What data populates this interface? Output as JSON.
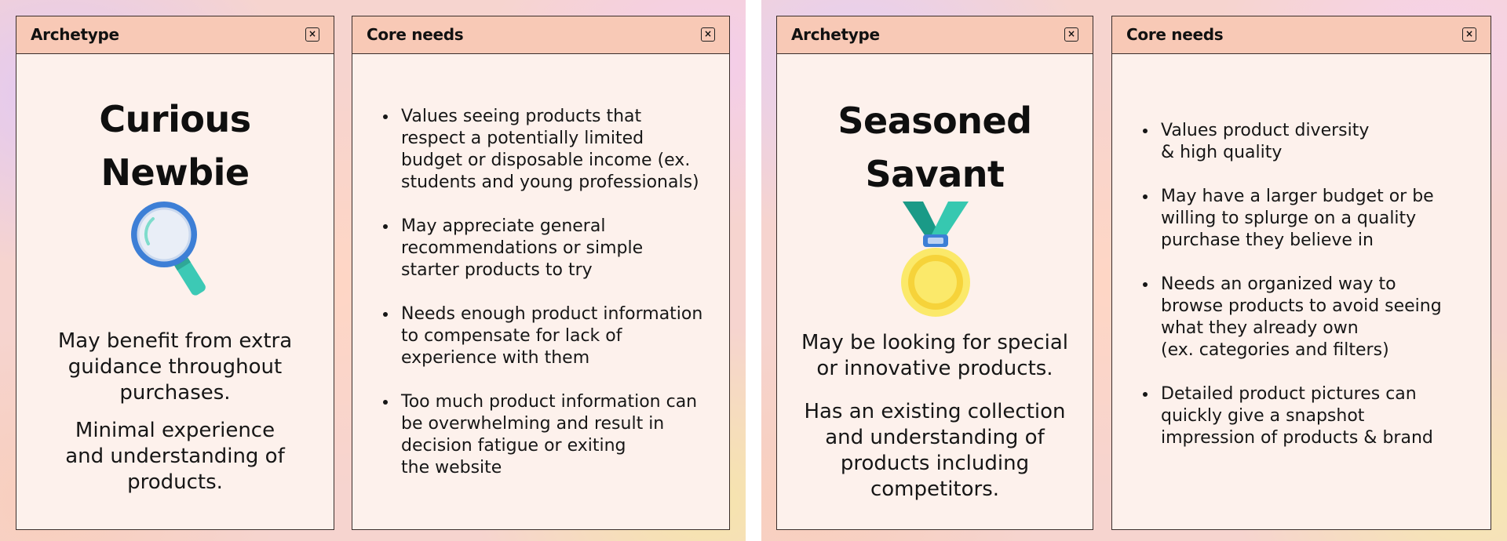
{
  "panels": [
    {
      "archetype_card": {
        "title": "Archetype",
        "close_icon": "×",
        "name_line1": "Curious",
        "name_line2": "Newbie",
        "illustration": "magnifying-glass-icon",
        "desc1": "May benefit from extra\nguidance throughout\npurchases.",
        "desc2": "Minimal experience\nand understanding of\nproducts."
      },
      "needs_card": {
        "title": "Core needs",
        "close_icon": "×",
        "items": [
          "Values seeing products that\nrespect a potentially limited\nbudget or disposable income (ex.\nstudents and young professionals)",
          "May appreciate general\nrecommendations or simple\nstarter products to try",
          "Needs enough product information\nto compensate for lack of\nexperience with them",
          "Too much product information can\nbe overwhelming and result in\ndecision fatigue or exiting\nthe website"
        ]
      }
    },
    {
      "archetype_card": {
        "title": "Archetype",
        "close_icon": "×",
        "name_line1": "Seasoned",
        "name_line2": "Savant",
        "illustration": "medal-icon",
        "desc1": "May be looking for special\nor innovative products.",
        "desc2": "Has an existing collection\nand understanding of\nproducts including\ncompetitors."
      },
      "needs_card": {
        "title": "Core needs",
        "close_icon": "×",
        "items": [
          "Values product diversity\n& high quality",
          "May have a larger budget or be\nwilling to splurge on a quality\npurchase they believe in",
          "Needs an organized way to\nbrowse products to avoid seeing\nwhat they already own\n(ex. categories and filters)",
          "Detailed product pictures can\nquickly give a snapshot\nimpression of products & brand"
        ]
      }
    }
  ],
  "colors": {
    "card_bg": "#fdf1ec",
    "header_bg": "#f8c9b6",
    "border": "#3a2e2b",
    "magnifier_ring": "#3d7fd6",
    "magnifier_handle": "#3cc9b5",
    "medal_gold": "#f8e04a",
    "medal_ribbon": "#1fa592"
  }
}
